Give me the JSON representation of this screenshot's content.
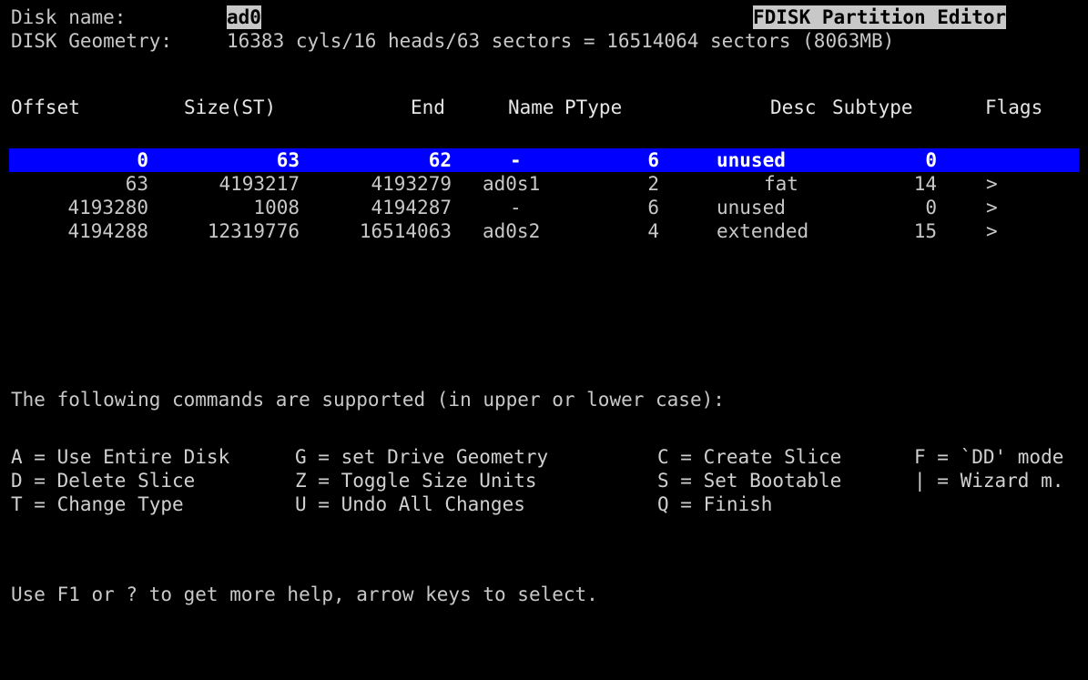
{
  "header": {
    "disk_label": "Disk name:",
    "disk_name": "ad0",
    "title": "FDISK Partition Editor",
    "geometry_label": "DISK Geometry:",
    "geometry_value": "16383 cyls/16 heads/63 sectors = 16514064 sectors (8063MB)"
  },
  "table": {
    "columns": [
      "Offset",
      "Size(ST)",
      "End",
      "Name",
      "PType",
      "Desc",
      "Subtype",
      "Flags"
    ],
    "rows": [
      {
        "offset": "0",
        "size": "63",
        "end": "62",
        "name": "-",
        "ptype": "6",
        "desc": "unused",
        "subtype": "0",
        "flags": ""
      },
      {
        "offset": "63",
        "size": "4193217",
        "end": "4193279",
        "name": "ad0s1",
        "ptype": "2",
        "desc": "fat",
        "subtype": "14",
        "flags": ">"
      },
      {
        "offset": "4193280",
        "size": "1008",
        "end": "4194287",
        "name": "-",
        "ptype": "6",
        "desc": "unused",
        "subtype": "0",
        "flags": ">"
      },
      {
        "offset": "4194288",
        "size": "12319776",
        "end": "16514063",
        "name": "ad0s2",
        "ptype": "4",
        "desc": "extended",
        "subtype": "15",
        "flags": ">"
      }
    ],
    "selected_row": 0
  },
  "commands": {
    "intro": "The following commands are supported (in upper or lower case):",
    "rows": [
      [
        "A = Use Entire Disk",
        "G = set Drive Geometry",
        "C = Create Slice",
        "F = `DD' mode"
      ],
      [
        "D = Delete Slice",
        "Z = Toggle Size Units",
        "S = Set Bootable",
        "| = Wizard m."
      ],
      [
        "T = Change Type",
        "U = Undo All Changes",
        "Q = Finish",
        ""
      ]
    ]
  },
  "footer": {
    "help": "Use F1 or ? to get more help, arrow keys to select."
  },
  "colors": {
    "background": "#000000",
    "text": "#c8c8c8",
    "selection": "#0000ff"
  }
}
